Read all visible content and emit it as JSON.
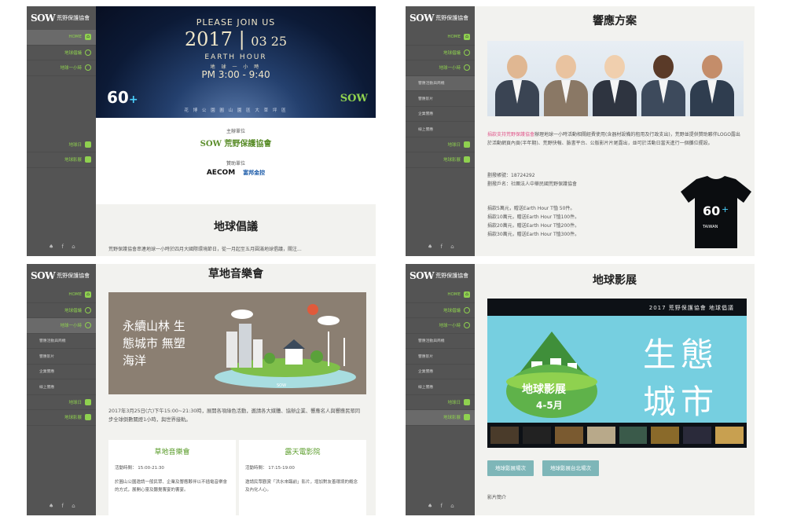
{
  "nav": {
    "logo_mark": "SOW",
    "logo_text": "荒野保護協會",
    "items": [
      {
        "label": "HOME"
      },
      {
        "label": "地球倡議"
      },
      {
        "label": "地球一小時"
      },
      {
        "label": "響應活動與商機"
      },
      {
        "label": "響應影片"
      },
      {
        "label": "企業響應"
      },
      {
        "label": "線上響應"
      },
      {
        "label": "地球日"
      },
      {
        "label": "地球影展"
      }
    ]
  },
  "panel1": {
    "please_join": "PLEASE JOIN US",
    "year": "2017",
    "date": "03 25",
    "event": "EARTH HOUR",
    "event_sub": "地 球 一 小 時",
    "time": "PM 3:00 - 9:40",
    "sixty": "60",
    "location": "花 博 公 園 圓 山 園 區 大 草 坪 區",
    "organizer_label": "主辦單位",
    "organizer": "SOW 荒野保護協會",
    "sponsor_label": "贊助單位",
    "sponsor1": "AECOM",
    "sponsor2": "富邦金控",
    "section_title": "地球倡議",
    "intro": "荒野保護協會串連地球一小時於四月大國際環境節日，從一月起至五月圓滿地球倡議，關注..."
  },
  "panel2": {
    "title": "響應方案",
    "para1_link": "捐款支持荒野保護協會",
    "para1": "辦理地球一小時活動相關經費使用(含器材設備的租用及行政支出)，荒野並提供贊助夥伴LOGO露出於活動網頁內頁(半年期)、荒野快報、臉書平台、公版影片片尾露出，並可於活動日當天進行一個攤位擺設。",
    "account_no": "劃撥帳號：18724292",
    "account_name": "劃撥戶名：社團法人中華民國荒野保護協會",
    "rewards": [
      "捐款5萬元，贈送Earth Hour T恤 50件。",
      "捐款10萬元，贈送Earth Hour T恤100件。",
      "捐款20萬元，贈送Earth Hour T恤200件。",
      "捐款30萬元，贈送Earth Hour T恤300件。"
    ],
    "tshirt_text": "TAIWAN"
  },
  "panel3": {
    "title": "草地音樂會",
    "art_text": "永續山林 生態城市 無塑海洋",
    "art_sow": "SOW",
    "desc": "2017年3月25日(六)下午15:00~21:30時，展開各項綠色活動，邀請各大媒體、協辦企業、響應名人與響應民眾同步全球倒數關燈1小時，與世界接軌。",
    "cards": [
      {
        "title": "草地音樂會",
        "time": "活動時間： 15:00-21:30",
        "body": "於圓山公園邀請一般民眾、企業及響應夥伴以不插電音樂會的方式，展開心靈及聽覺饗宴的饗宴。"
      },
      {
        "title": "露天電影院",
        "time": "活動時間： 17:15-19:00",
        "body": "邀請民眾觀賞「洪水來臨前」影片，增加對友善環境的概念及內化人心。"
      }
    ]
  },
  "panel4": {
    "title": "地球影展",
    "film_bar": "2017 荒野保護協會 地球倡議",
    "film_big": "生態城市",
    "film_label": "地球影展",
    "film_date": "4-5月",
    "btn1": "地球影展場次",
    "btn2": "地球影展台北場次",
    "section": "影片簡介"
  },
  "colors": {
    "sidebar": "#545454",
    "accent_green": "#8fd14f",
    "link_pink": "#e0578b",
    "button_teal": "#7eb6b8"
  }
}
